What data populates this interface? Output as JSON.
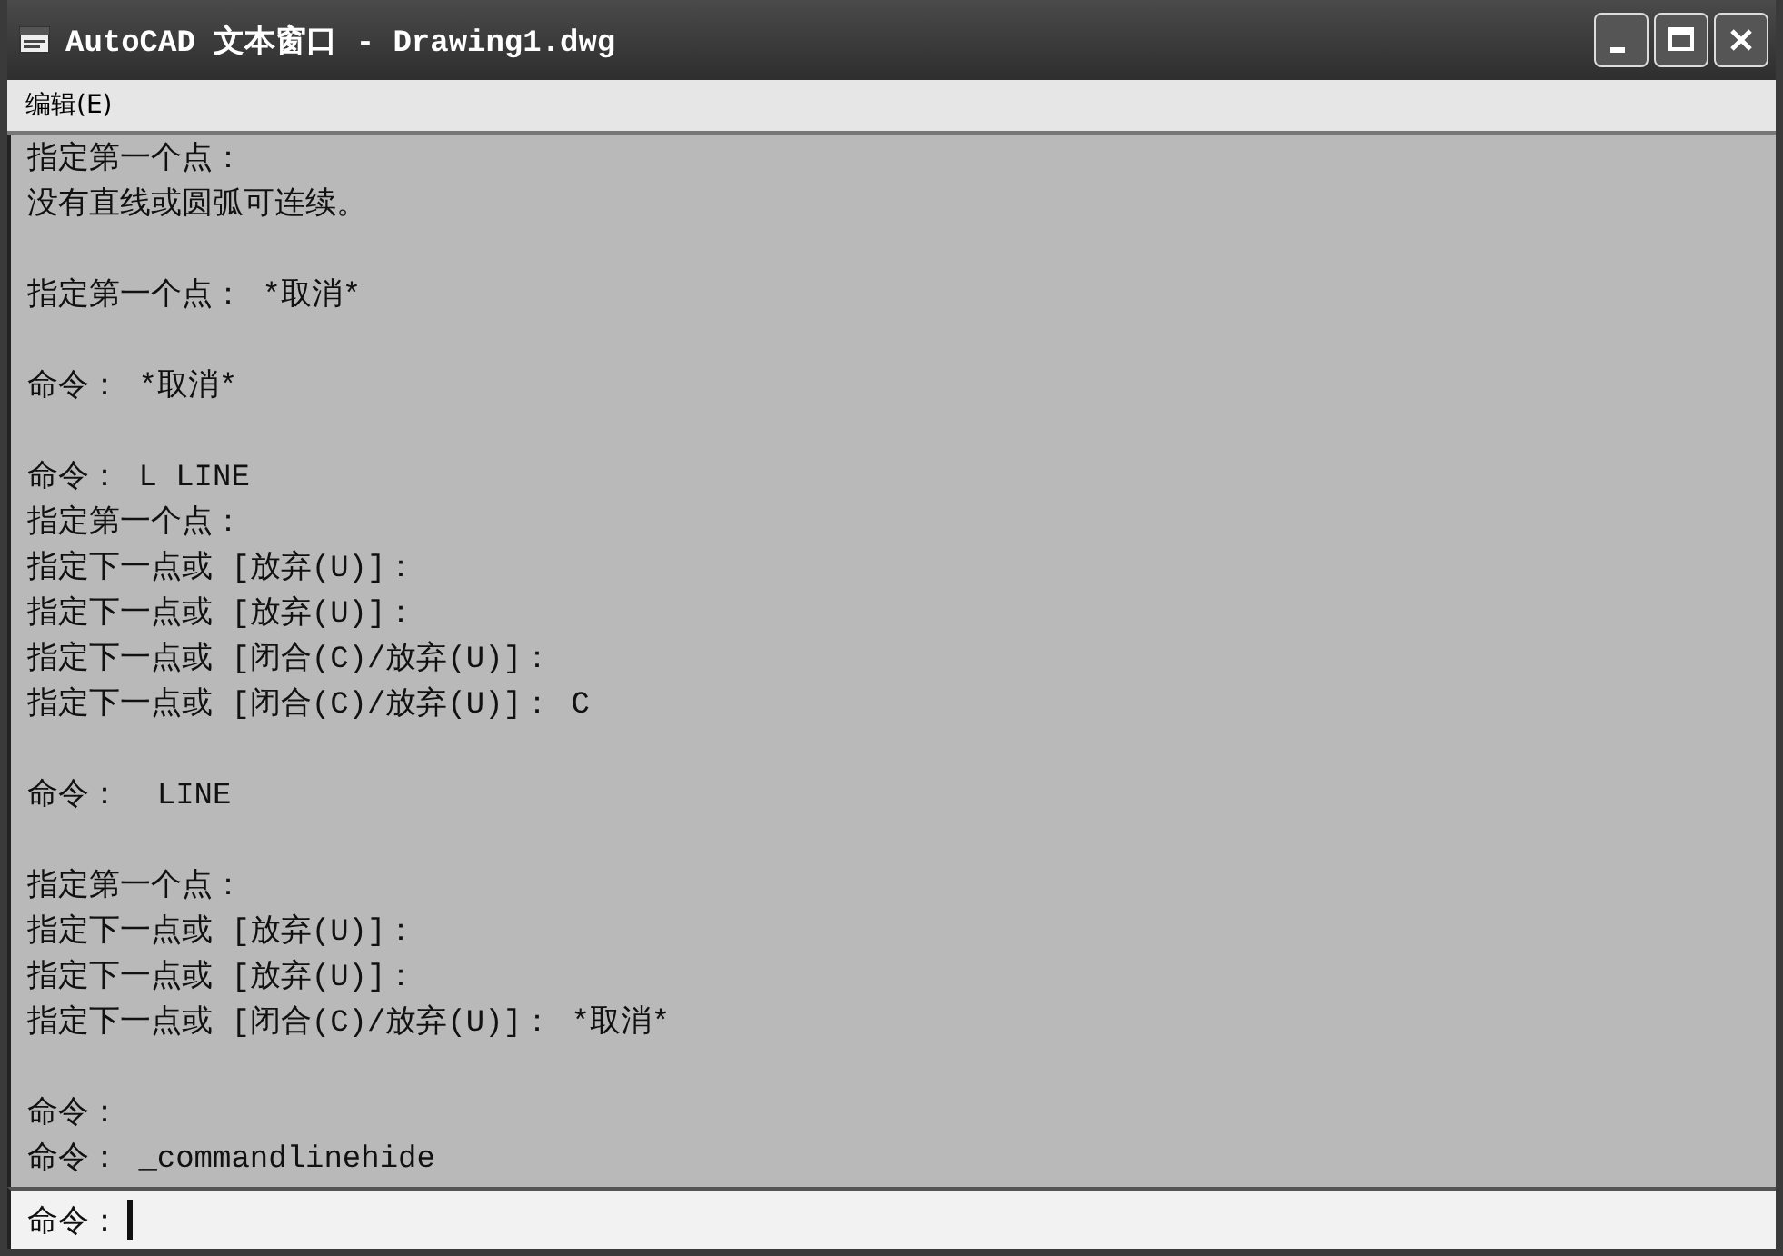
{
  "window": {
    "title": "AutoCAD 文本窗口 - Drawing1.dwg"
  },
  "menu": [
    {
      "label": "编辑(E)"
    }
  ],
  "log": [
    [
      "指定第一个点：",
      "没有直线或圆弧可连续。"
    ],
    [
      "指定第一个点： *取消*"
    ],
    [
      "命令： *取消*"
    ],
    [
      "命令： L LINE",
      "指定第一个点：",
      "指定下一点或 [放弃(U)]：",
      "指定下一点或 [放弃(U)]：",
      "指定下一点或 [闭合(C)/放弃(U)]：",
      "指定下一点或 [闭合(C)/放弃(U)]： C"
    ],
    [
      "命令：  LINE"
    ],
    [
      "指定第一个点：",
      "指定下一点或 [放弃(U)]：",
      "指定下一点或 [放弃(U)]：",
      "指定下一点或 [闭合(C)/放弃(U)]： *取消*"
    ],
    [
      "命令：",
      "命令： _commandlinehide"
    ]
  ],
  "command_line": {
    "prompt": "命令："
  }
}
